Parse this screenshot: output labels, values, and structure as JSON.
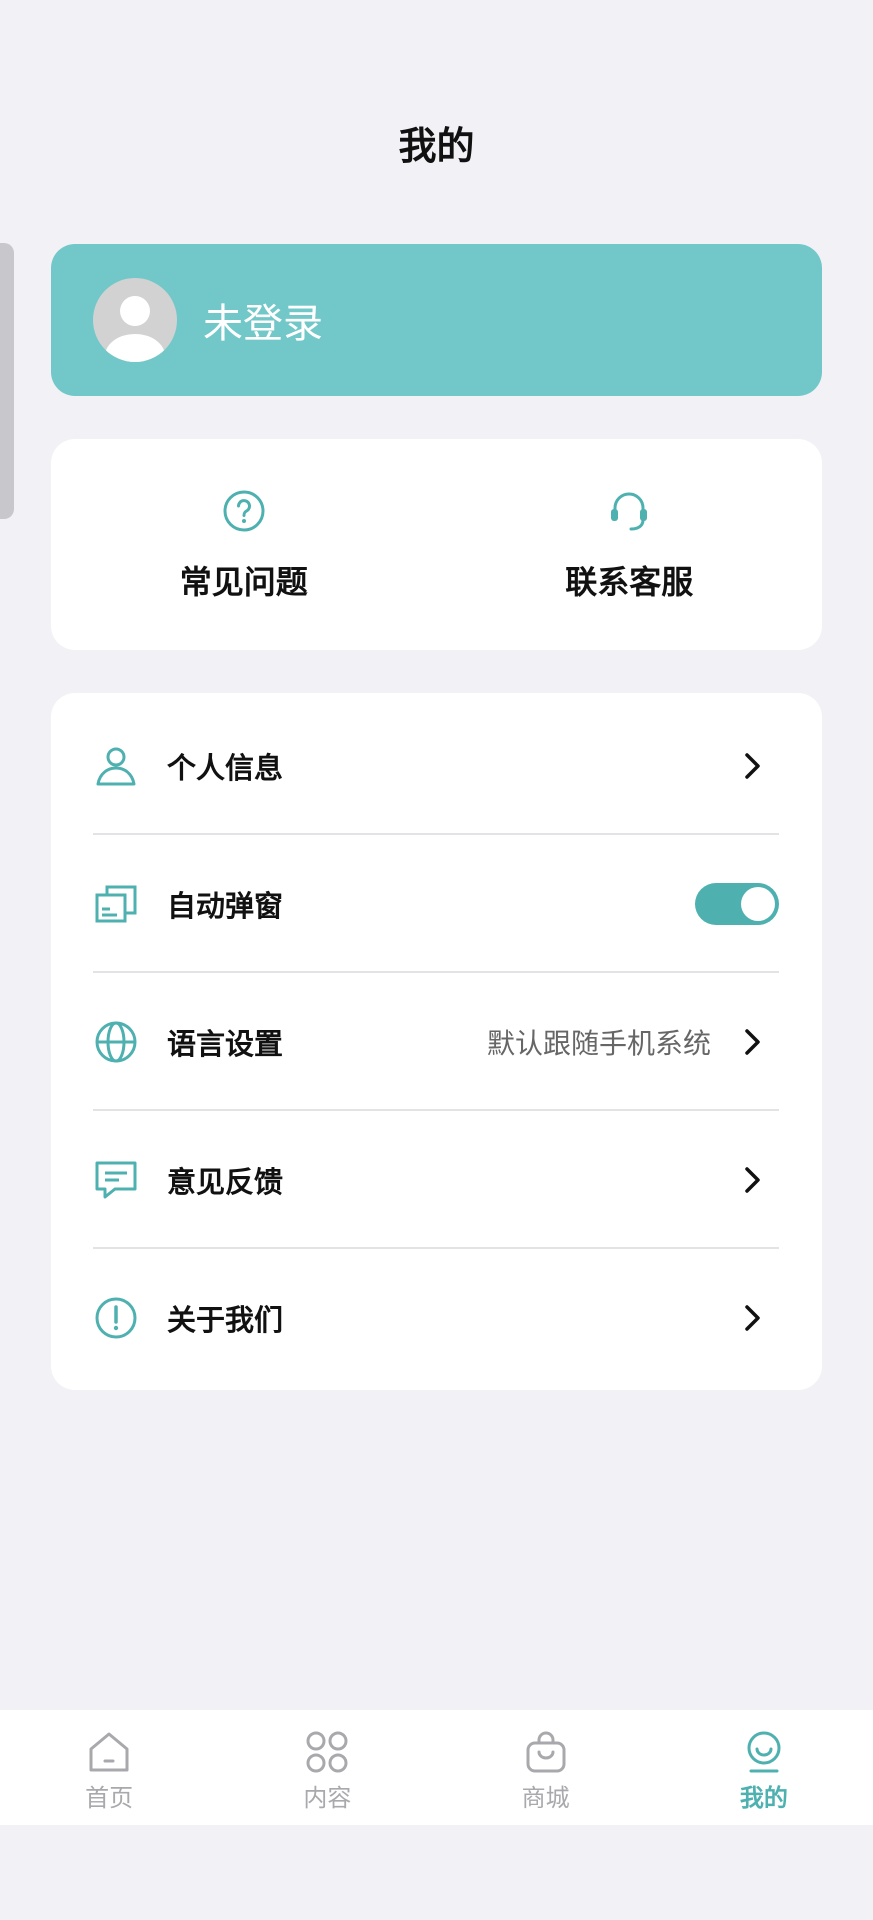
{
  "header": {
    "title": "我的"
  },
  "profile": {
    "login_text": "未登录"
  },
  "quick_actions": [
    {
      "label": "常见问题",
      "icon": "question-circle-icon"
    },
    {
      "label": "联系客服",
      "icon": "headset-icon"
    }
  ],
  "settings": {
    "personal_info": {
      "label": "个人信息"
    },
    "auto_popup": {
      "label": "自动弹窗",
      "enabled": true
    },
    "language": {
      "label": "语言设置",
      "value": "默认跟随手机系统"
    },
    "feedback": {
      "label": "意见反馈"
    },
    "about": {
      "label": "关于我们"
    }
  },
  "tabbar": {
    "items": [
      {
        "label": "首页",
        "icon": "home-icon"
      },
      {
        "label": "内容",
        "icon": "grid-icon"
      },
      {
        "label": "商城",
        "icon": "shopping-bag-icon"
      },
      {
        "label": "我的",
        "icon": "profile-face-icon",
        "active": true
      }
    ]
  },
  "colors": {
    "accent": "#4fb0b0",
    "login_card": "#72c8c8",
    "background": "#f2f1f6",
    "inactive": "#a9a9ad"
  }
}
